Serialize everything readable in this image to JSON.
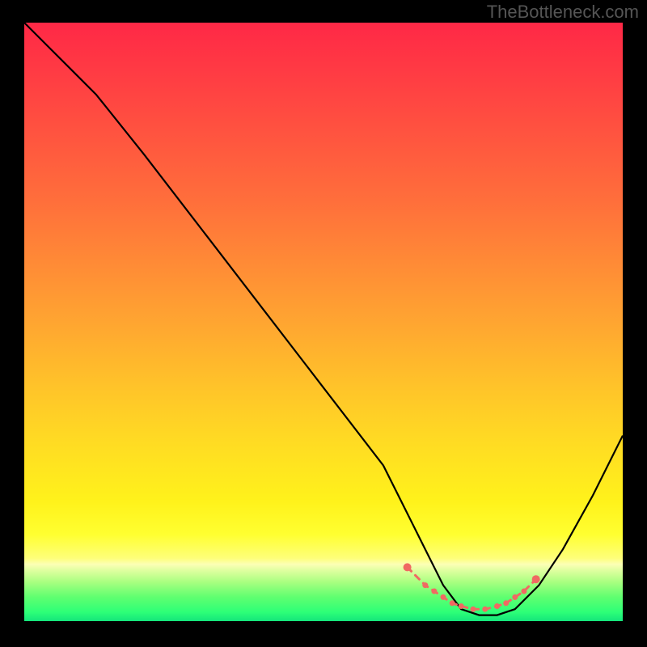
{
  "watermark": "TheBottleneck.com",
  "colors": {
    "black": "#000000",
    "marker": "#f06a62"
  },
  "gradient_stops": [
    {
      "offset": 0.0,
      "color": "#ff2846"
    },
    {
      "offset": 0.1,
      "color": "#ff3f43"
    },
    {
      "offset": 0.2,
      "color": "#ff573f"
    },
    {
      "offset": 0.3,
      "color": "#ff6f3b"
    },
    {
      "offset": 0.4,
      "color": "#ff8a36"
    },
    {
      "offset": 0.5,
      "color": "#ffa531"
    },
    {
      "offset": 0.6,
      "color": "#ffc12a"
    },
    {
      "offset": 0.7,
      "color": "#ffdb23"
    },
    {
      "offset": 0.8,
      "color": "#fff21b"
    },
    {
      "offset": 0.855,
      "color": "#ffff30"
    },
    {
      "offset": 0.895,
      "color": "#feff7a"
    },
    {
      "offset": 0.905,
      "color": "#fcffb5"
    },
    {
      "offset": 0.915,
      "color": "#e0ffa0"
    },
    {
      "offset": 0.935,
      "color": "#a8ff80"
    },
    {
      "offset": 0.96,
      "color": "#5fff70"
    },
    {
      "offset": 0.985,
      "color": "#2dff77"
    },
    {
      "offset": 1.0,
      "color": "#14e57b"
    }
  ],
  "chart_data": {
    "type": "line",
    "title": "",
    "xlabel": "",
    "ylabel": "",
    "xlim": [
      0,
      100
    ],
    "ylim": [
      0,
      100
    ],
    "x": [
      0,
      4,
      8,
      12,
      20,
      30,
      40,
      50,
      60,
      64,
      67,
      70,
      73,
      76,
      79,
      82,
      86,
      90,
      95,
      100
    ],
    "values": [
      100,
      96,
      92,
      88,
      78,
      65,
      52,
      39,
      26,
      18,
      12,
      6,
      2,
      1,
      1,
      2,
      6,
      12,
      21,
      31
    ],
    "optimal_range": {
      "x": [
        64,
        67,
        68.5,
        70,
        71.5,
        73,
        75,
        77,
        79,
        80.5,
        82,
        83.5,
        85.5
      ],
      "values": [
        9,
        6,
        5,
        4,
        3,
        2.5,
        2,
        2,
        2.5,
        3,
        4,
        5,
        7
      ]
    }
  }
}
